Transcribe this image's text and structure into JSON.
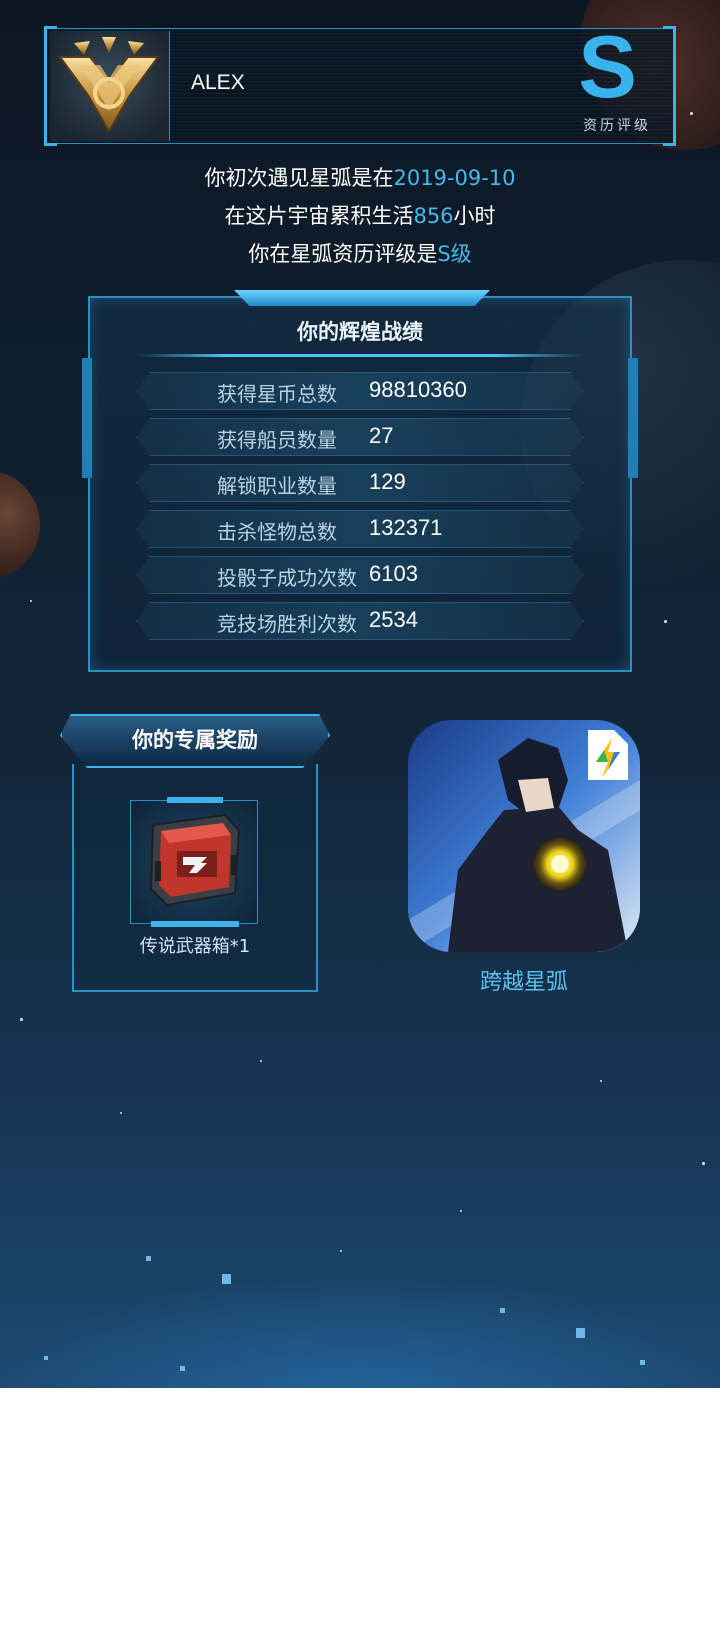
{
  "player": {
    "name": "ALEX",
    "grade_letter": "S",
    "grade_caption": "资历评级"
  },
  "intro": {
    "line1_prefix": "你初次遇见星弧是在",
    "first_date": "2019-09-10",
    "line2_prefix": "在这片宇宙累积生活",
    "hours": "856",
    "line2_suffix": "小时",
    "line3_prefix": "你在星弧资历评级是",
    "grade_text": "S级"
  },
  "stats": {
    "title": "你的辉煌战绩",
    "rows": [
      {
        "label": "获得星币总数",
        "value": "98810360"
      },
      {
        "label": "获得船员数量",
        "value": "27"
      },
      {
        "label": "解锁职业数量",
        "value": "129"
      },
      {
        "label": "击杀怪物总数",
        "value": "132371"
      },
      {
        "label": "投骰子成功次数",
        "value": "6103"
      },
      {
        "label": "竞技场胜利次数",
        "value": "2534"
      }
    ]
  },
  "reward": {
    "title": "你的专属奖励",
    "item_name": "传说武器箱*1"
  },
  "app": {
    "name": "跨越星弧"
  },
  "colors": {
    "accent": "#44b9ea",
    "frame": "#2b8fc2",
    "background_top": "#0c1622",
    "background_bottom": "#1d4a72"
  },
  "icons": {
    "avatar": "gold-rank-emblem-icon",
    "reward_item": "weapon-crate-icon",
    "app": "game-app-icon"
  }
}
